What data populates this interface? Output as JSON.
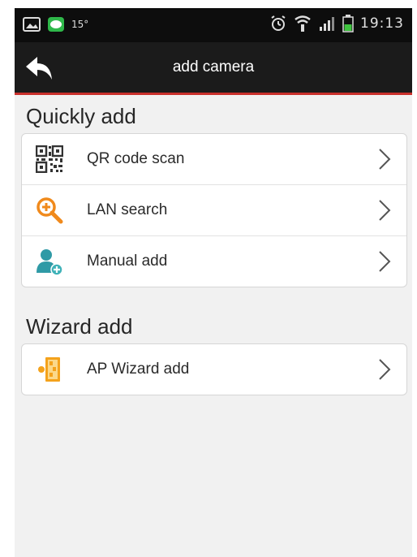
{
  "status_bar": {
    "temperature": "15°",
    "time": "19:13"
  },
  "action_bar": {
    "title": "add camera"
  },
  "quickly_add": {
    "heading": "Quickly add",
    "items": [
      {
        "label": "QR code scan",
        "icon": "qr-code-icon"
      },
      {
        "label": "LAN search",
        "icon": "magnifier-plus-icon"
      },
      {
        "label": "Manual add",
        "icon": "user-add-icon"
      }
    ]
  },
  "wizard_add": {
    "heading": "Wizard add",
    "items": [
      {
        "label": "AP Wizard add",
        "icon": "ap-wizard-icon"
      }
    ]
  },
  "colors": {
    "action_bar_bg": "#1b1b1b",
    "accent_red": "#c9302c",
    "search_icon_orange": "#f08a1c",
    "user_icon_teal": "#2f9aa6"
  }
}
